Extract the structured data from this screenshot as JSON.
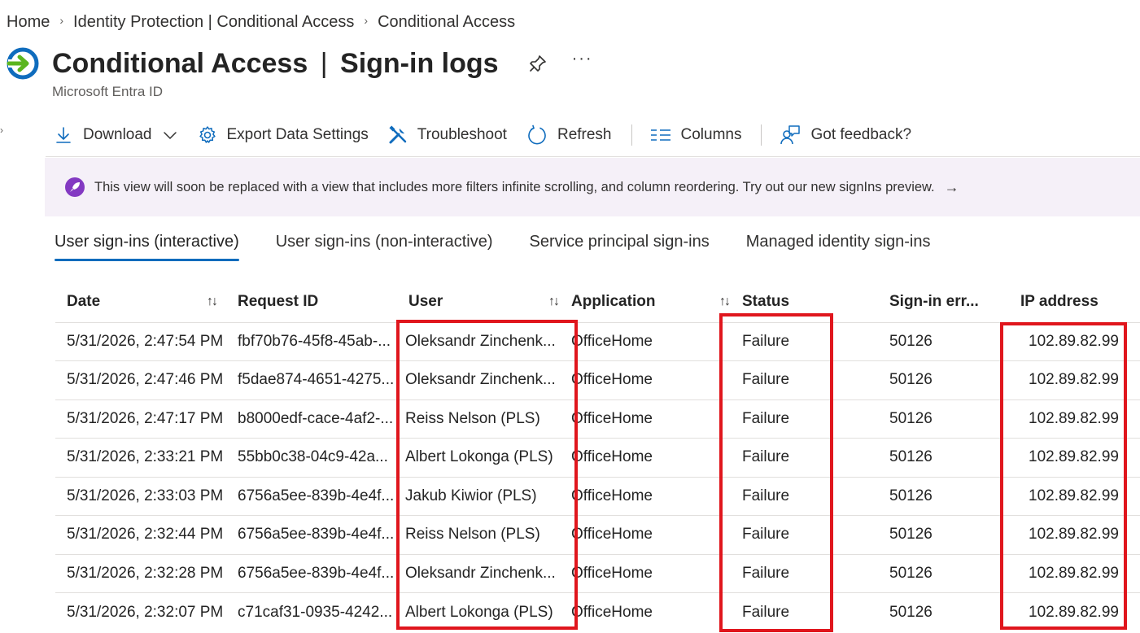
{
  "breadcrumb": [
    {
      "label": "Home"
    },
    {
      "label": "Identity Protection | Conditional Access"
    },
    {
      "label": "Conditional Access"
    }
  ],
  "header": {
    "title_strong": "Conditional Access",
    "title_pipe": "|",
    "title_rest": "Sign-in logs",
    "more_label": "···",
    "subtitle": "Microsoft Entra ID"
  },
  "toolbar": {
    "download": "Download",
    "export": "Export Data Settings",
    "troubleshoot": "Troubleshoot",
    "refresh": "Refresh",
    "columns": "Columns",
    "feedback": "Got feedback?"
  },
  "banner": {
    "text": "This view will soon be replaced with a view that includes more filters infinite scrolling, and column reordering. Try out our new signIns preview.",
    "arrow": "→"
  },
  "tabs": [
    {
      "label": "User sign-ins (interactive)",
      "active": true
    },
    {
      "label": "User sign-ins (non-interactive)",
      "active": false
    },
    {
      "label": "Service principal sign-ins",
      "active": false
    },
    {
      "label": "Managed identity sign-ins",
      "active": false
    }
  ],
  "table": {
    "columns": {
      "date": "Date",
      "request_id": "Request ID",
      "user": "User",
      "application": "Application",
      "status": "Status",
      "error": "Sign-in err...",
      "ip": "IP address"
    },
    "rows": [
      {
        "date": "5/31/2026, 2:47:54 PM",
        "request_id": "fbf70b76-45f8-45ab-...",
        "user": "Oleksandr Zinchenk...",
        "application": "OfficeHome",
        "status": "Failure",
        "error": "50126",
        "ip": "102.89.82.99"
      },
      {
        "date": "5/31/2026, 2:47:46 PM",
        "request_id": "f5dae874-4651-4275...",
        "user": "Oleksandr Zinchenk...",
        "application": "OfficeHome",
        "status": "Failure",
        "error": "50126",
        "ip": "102.89.82.99"
      },
      {
        "date": "5/31/2026, 2:47:17 PM",
        "request_id": "b8000edf-cace-4af2-...",
        "user": "Reiss Nelson (PLS)",
        "application": "OfficeHome",
        "status": "Failure",
        "error": "50126",
        "ip": "102.89.82.99"
      },
      {
        "date": "5/31/2026, 2:33:21 PM",
        "request_id": "55bb0c38-04c9-42a...",
        "user": "Albert Lokonga (PLS)",
        "application": "OfficeHome",
        "status": "Failure",
        "error": "50126",
        "ip": "102.89.82.99"
      },
      {
        "date": "5/31/2026, 2:33:03 PM",
        "request_id": "6756a5ee-839b-4e4f...",
        "user": "Jakub Kiwior (PLS)",
        "application": "OfficeHome",
        "status": "Failure",
        "error": "50126",
        "ip": "102.89.82.99"
      },
      {
        "date": "5/31/2026, 2:32:44 PM",
        "request_id": "6756a5ee-839b-4e4f...",
        "user": "Reiss Nelson (PLS)",
        "application": "OfficeHome",
        "status": "Failure",
        "error": "50126",
        "ip": "102.89.82.99"
      },
      {
        "date": "5/31/2026, 2:32:28 PM",
        "request_id": "6756a5ee-839b-4e4f...",
        "user": "Oleksandr Zinchenk...",
        "application": "OfficeHome",
        "status": "Failure",
        "error": "50126",
        "ip": "102.89.82.99"
      },
      {
        "date": "5/31/2026, 2:32:07 PM",
        "request_id": "c71caf31-0935-4242...",
        "user": "Albert Lokonga (PLS)",
        "application": "OfficeHome",
        "status": "Failure",
        "error": "50126",
        "ip": "102.89.82.99"
      }
    ]
  },
  "colors": {
    "accent": "#0f6cbd",
    "highlight": "#e0161d",
    "banner_bg": "#f5f0f8",
    "banner_icon": "#8339c2"
  },
  "icons": {
    "title": "conditional-access-icon",
    "pin": "pin-icon",
    "download": "download-icon",
    "export": "gear-icon",
    "troubleshoot": "wrench-icon",
    "refresh": "refresh-icon",
    "columns": "columns-icon",
    "feedback": "feedback-icon",
    "banner": "rocket-icon",
    "sort": "sort-icon"
  }
}
